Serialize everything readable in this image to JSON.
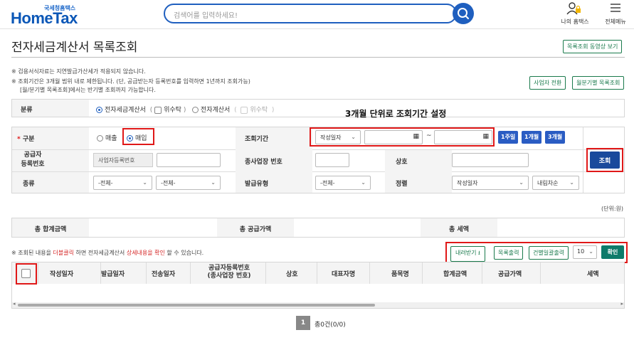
{
  "header": {
    "logo_sub": "국세청홈택스",
    "logo_main": "HomeTax",
    "search_placeholder": "검색어를 입력하세요!",
    "my_hometax_label": "나의 홈택스",
    "all_menu_label": "전체메뉴"
  },
  "page": {
    "title": "전자세금계산서 목록조회",
    "video_button": "목록조회 동영상 보기"
  },
  "notes": {
    "line1": "※ 검용서식자료는 지연발급가산세가 적용되지 않습니다.",
    "line2": "※ 조회기간은 3개월 범위 내로 제한됩니다. (단, 공급받는자 등록번호를 입력하면 1년까지 조회가능)",
    "line3": "[월/분기별 목록조회]에서는 반기별 조회까지 가능합니다.",
    "switch_business": "사업자 전환",
    "monthly_list": "월분기별 목록조회"
  },
  "category": {
    "label": "분류",
    "opt_electronic_invoice": "전자세금계산서",
    "opt_consign1": "위수탁",
    "opt_electronic_bill": "전자계산서",
    "opt_consign2": "위수탁"
  },
  "annotation": {
    "caption": "3개월 단위로 조회기간 설정"
  },
  "search_form": {
    "type_label": "구분",
    "type_sales": "매출",
    "type_purchase": "매입",
    "period_label": "조회기간",
    "period_select": "작성일자",
    "date_sep": "~",
    "btn_1week": "1주일",
    "btn_1month": "1개월",
    "btn_3month": "3개월",
    "supplier_label1": "공급자",
    "supplier_label2": "등록번호",
    "biz_no_placeholder": "사업자등록번호",
    "branch_label": "종사업장 번호",
    "company_label": "상호",
    "search_btn": "조회",
    "kind_label": "종류",
    "kind_sel1": "-전체-",
    "kind_sel2": "-전체-",
    "issue_type_label": "발급유형",
    "issue_type_sel": "-전체-",
    "sort_label": "정렬",
    "sort_sel": "작성일자",
    "order_sel": "내림차순"
  },
  "unit_label": "(단위:원)",
  "totals": {
    "total_sum_label": "총 합계금액",
    "total_supply_label": "총 공급가액",
    "total_tax_label": "총 세액"
  },
  "list_tools": {
    "note_prefix": "※ 조회된 내용을 ",
    "note_dblclick": "더블클릭",
    "note_mid": " 하면 전자세금계산서 ",
    "note_detail": "상세내용을 확인",
    "note_suffix": " 할 수 있습니다.",
    "download_btn": "내려받기",
    "print_list_btn": "목록출력",
    "print_each_btn": "건별일괄출력",
    "page_size": "10",
    "confirm_btn": "확인"
  },
  "table": {
    "columns": [
      "작성일자",
      "발급일자",
      "전송일자",
      "공급자등록번호",
      "(종사업장 번호)",
      "상호",
      "대표자명",
      "품목명",
      "합계금액",
      "공급가액",
      "세액"
    ]
  },
  "pager": {
    "current": "1",
    "total": "총0건(0/0)"
  },
  "colors": {
    "brand": "#0b57b7",
    "accent_blue": "#2a5cc3",
    "highlight_red": "#e01818",
    "teal": "#0e7a6a"
  }
}
